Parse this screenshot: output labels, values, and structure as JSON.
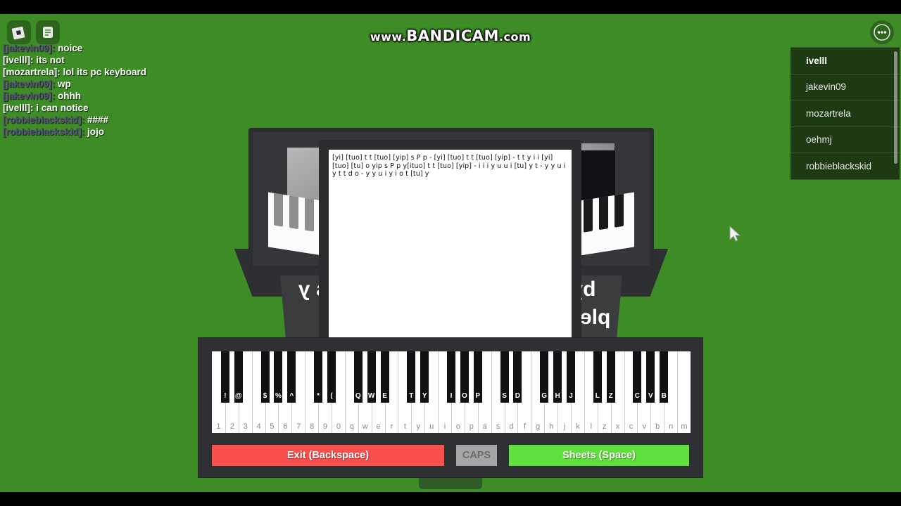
{
  "watermark": {
    "prefix": "www.",
    "brand": "BANDICAM",
    "suffix": ".com"
  },
  "topbar": {
    "roblox_button_label": "Roblox Menu",
    "chat_button_label": "Chat",
    "more_button_label": "More Options",
    "icons": [
      "roblox-logo-icon",
      "chat-icon",
      "ellipsis-icon"
    ]
  },
  "chat": {
    "messages": [
      {
        "name": "[jakevin09]:",
        "text": "noice",
        "name_color": "#5c4a86"
      },
      {
        "name": "[ivelll]:",
        "text": "its not",
        "name_color": "#ffffff"
      },
      {
        "name": "[mozartrela]:",
        "text": "lol its pc keyboard",
        "name_color": "#ffffff"
      },
      {
        "name": "[jakevin09]:",
        "text": "wp",
        "name_color": "#5c4a86"
      },
      {
        "name": "[jakevin09]:",
        "text": "ohhh",
        "name_color": "#5c4a86"
      },
      {
        "name": "[ivelll]:",
        "text": "i can notice",
        "name_color": "#ffffff"
      },
      {
        "name": "[robbieblackskid]:",
        "text": "####",
        "name_color": "#5c4a86"
      },
      {
        "name": "[robbieblackskid]:",
        "text": "jojo",
        "name_color": "#5c4a86"
      }
    ]
  },
  "playerlist": {
    "players": [
      {
        "name": "ivelll",
        "is_local": true
      },
      {
        "name": "jakevin09",
        "is_local": false
      },
      {
        "name": "mozartrela",
        "is_local": false
      },
      {
        "name": "oehmj",
        "is_local": false
      },
      {
        "name": "robbieblackskid",
        "is_local": false
      }
    ]
  },
  "sheet": {
    "lines": [
      "[yi] [tuo] t t [tuo] [yip] s P p - [yi] [tuo] t t [tuo] [yip] - t t y i i [yi]",
      "[tuo] [tu] o yip s P p y[ituo] t t [tuo] [yip] - i i i y u u i [tu] y t - y y u i",
      "y t t d o - y y u i y i o t [tu] y"
    ]
  },
  "piano": {
    "white_keys": [
      "1",
      "2",
      "3",
      "4",
      "5",
      "6",
      "7",
      "8",
      "9",
      "0",
      "q",
      "w",
      "e",
      "r",
      "t",
      "y",
      "u",
      "i",
      "o",
      "p",
      "a",
      "s",
      "d",
      "f",
      "g",
      "h",
      "j",
      "k",
      "l",
      "z",
      "x",
      "c",
      "v",
      "b",
      "n",
      "m"
    ],
    "black_keys": [
      {
        "label": "!",
        "after": 0
      },
      {
        "label": "@",
        "after": 1
      },
      {
        "label": "$",
        "after": 3
      },
      {
        "label": "%",
        "after": 4
      },
      {
        "label": "^",
        "after": 5
      },
      {
        "label": "*",
        "after": 7
      },
      {
        "label": "(",
        "after": 8
      },
      {
        "label": "Q",
        "after": 10
      },
      {
        "label": "W",
        "after": 11
      },
      {
        "label": "E",
        "after": 12
      },
      {
        "label": "T",
        "after": 14
      },
      {
        "label": "Y",
        "after": 15
      },
      {
        "label": "I",
        "after": 17
      },
      {
        "label": "O",
        "after": 18
      },
      {
        "label": "P",
        "after": 19
      },
      {
        "label": "S",
        "after": 21
      },
      {
        "label": "D",
        "after": 22
      },
      {
        "label": "G",
        "after": 24
      },
      {
        "label": "H",
        "after": 25
      },
      {
        "label": "J",
        "after": 26
      },
      {
        "label": "L",
        "after": 28
      },
      {
        "label": "Z",
        "after": 29
      },
      {
        "label": "C",
        "after": 31
      },
      {
        "label": "V",
        "after": 32
      },
      {
        "label": "B",
        "after": 33
      }
    ],
    "controls": {
      "exit_label": "Exit (Backspace)",
      "caps_label": "CAPS",
      "sheets_label": "Sheets (Space)"
    }
  },
  "prop": {
    "sign_left_text": "as y",
    "sign_right_text": "by pless"
  },
  "colors": {
    "background_green": "#3d8c26",
    "exit_red": "#f9504e",
    "sheets_green": "#5fe03c",
    "caps_grey": "#a5a5a5",
    "panel_dark": "#2f3033"
  },
  "cursor": {
    "name": "mouse-pointer"
  }
}
